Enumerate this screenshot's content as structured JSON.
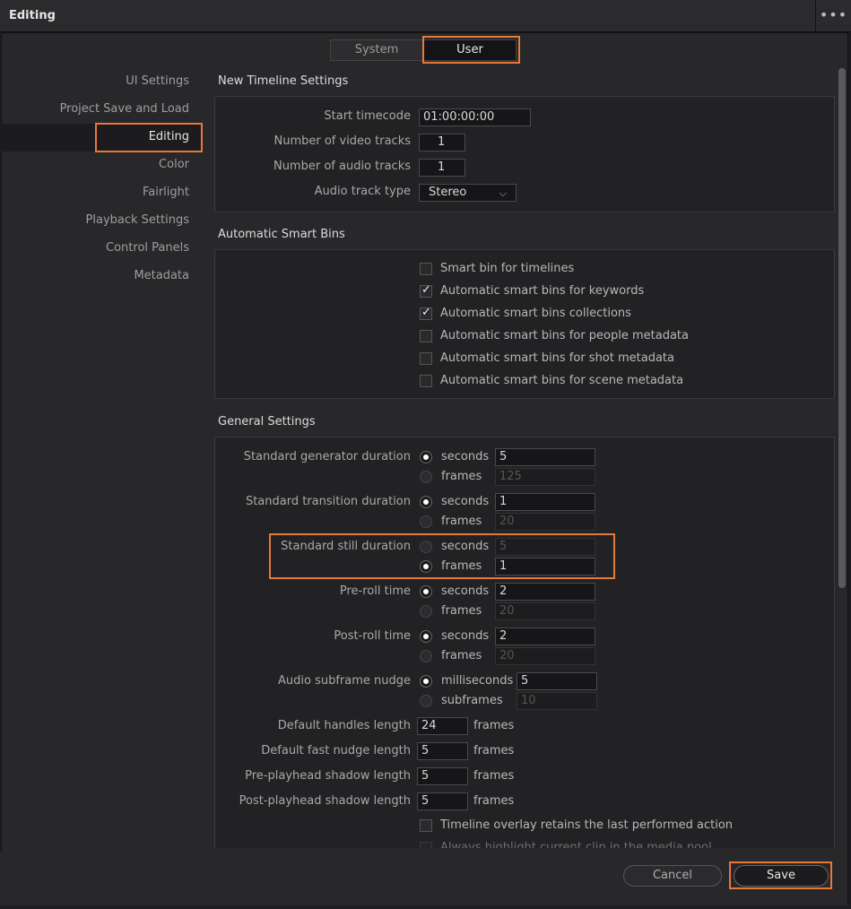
{
  "window": {
    "title": "Editing",
    "more_icon": "ellipsis-icon"
  },
  "tabs": [
    {
      "label": "System",
      "active": false
    },
    {
      "label": "User",
      "active": true
    }
  ],
  "sidebar": {
    "items": [
      {
        "label": "UI Settings"
      },
      {
        "label": "Project Save and Load"
      },
      {
        "label": "Editing"
      },
      {
        "label": "Color"
      },
      {
        "label": "Fairlight"
      },
      {
        "label": "Playback Settings"
      },
      {
        "label": "Control Panels"
      },
      {
        "label": "Metadata"
      }
    ],
    "active_index": 2
  },
  "new_timeline": {
    "title": "New Timeline Settings",
    "start_timecode_label": "Start timecode",
    "start_timecode": "01:00:00:00",
    "video_tracks_label": "Number of video tracks",
    "video_tracks": "1",
    "audio_tracks_label": "Number of audio tracks",
    "audio_tracks": "1",
    "audio_type_label": "Audio track type",
    "audio_type": "Stereo"
  },
  "smart_bins": {
    "title": "Automatic Smart Bins",
    "items": [
      {
        "label": "Smart bin for timelines",
        "checked": false
      },
      {
        "label": "Automatic smart bins for keywords",
        "checked": true
      },
      {
        "label": "Automatic smart bins collections",
        "checked": true
      },
      {
        "label": "Automatic smart bins for people metadata",
        "checked": false
      },
      {
        "label": "Automatic smart bins for shot metadata",
        "checked": false
      },
      {
        "label": "Automatic smart bins for scene metadata",
        "checked": false
      }
    ]
  },
  "general": {
    "title": "General Settings",
    "durations": [
      {
        "label": "Standard generator duration",
        "unit_a": "seconds",
        "value_a": "5",
        "unit_b": "frames",
        "value_b": "125",
        "selected": "a"
      },
      {
        "label": "Standard transition duration",
        "unit_a": "seconds",
        "value_a": "1",
        "unit_b": "frames",
        "value_b": "20",
        "selected": "a"
      },
      {
        "label": "Standard still duration",
        "unit_a": "seconds",
        "value_a": "5",
        "unit_b": "frames",
        "value_b": "1",
        "selected": "b"
      },
      {
        "label": "Pre-roll time",
        "unit_a": "seconds",
        "value_a": "2",
        "unit_b": "frames",
        "value_b": "20",
        "selected": "a"
      },
      {
        "label": "Post-roll time",
        "unit_a": "seconds",
        "value_a": "2",
        "unit_b": "frames",
        "value_b": "20",
        "selected": "a"
      },
      {
        "label": "Audio subframe nudge",
        "unit_a": "milliseconds",
        "value_a": "5",
        "unit_b": "subframes",
        "value_b": "10",
        "selected": "a"
      }
    ],
    "lengths": [
      {
        "label": "Default handles length",
        "value": "24",
        "unit": "frames"
      },
      {
        "label": "Default fast nudge length",
        "value": "5",
        "unit": "frames"
      },
      {
        "label": "Pre-playhead shadow length",
        "value": "5",
        "unit": "frames"
      },
      {
        "label": "Post-playhead shadow length",
        "value": "5",
        "unit": "frames"
      }
    ],
    "options": [
      {
        "label": "Timeline overlay retains the last performed action",
        "checked": false
      },
      {
        "label": "Always highlight current clip in the media pool",
        "checked": false
      }
    ]
  },
  "footer": {
    "cancel": "Cancel",
    "save": "Save"
  },
  "colors": {
    "highlight": "#e8773a",
    "background": "#28282b",
    "panel": "#222224"
  }
}
